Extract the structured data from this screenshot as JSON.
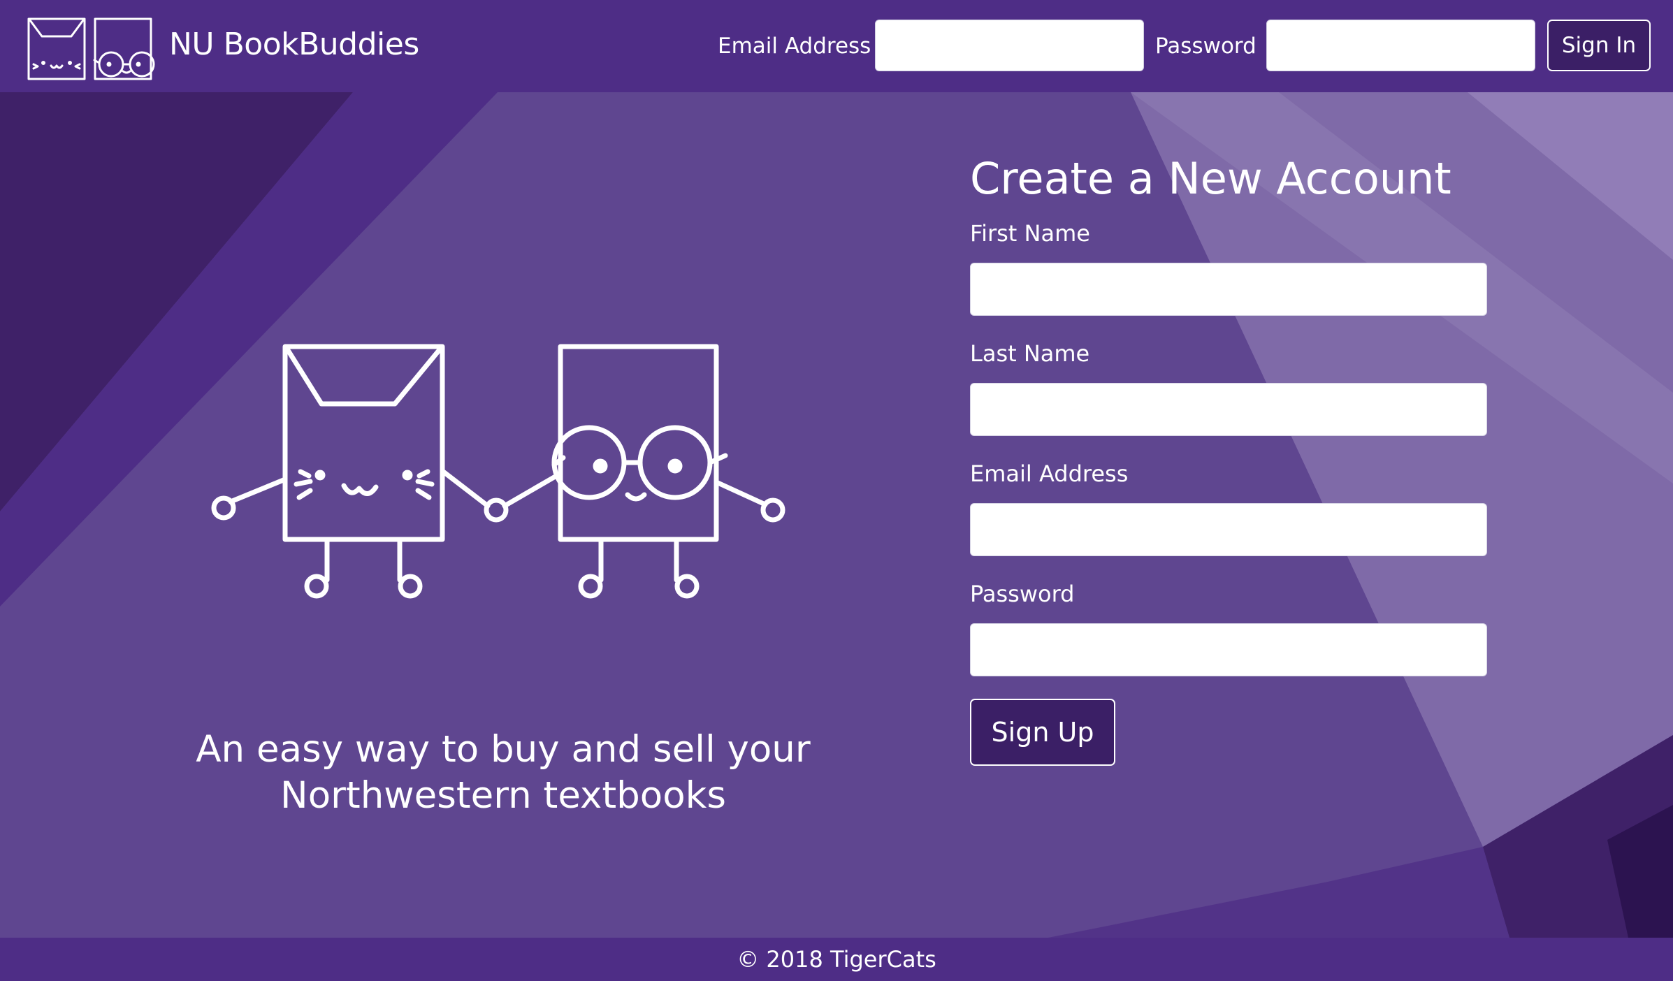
{
  "header": {
    "brand_name": "NU BookBuddies",
    "email_label": "Email Address",
    "email_value": "",
    "password_label": "Password",
    "password_value": "",
    "signin_label": "Sign In"
  },
  "hero": {
    "tagline_line1": "An easy way to buy and sell your",
    "tagline_line2": "Northwestern textbooks"
  },
  "signup": {
    "title": "Create a New Account",
    "fields": [
      {
        "label": "First Name",
        "value": ""
      },
      {
        "label": "Last Name",
        "value": ""
      },
      {
        "label": "Email Address",
        "value": ""
      },
      {
        "label": "Password",
        "value": ""
      }
    ],
    "submit_label": "Sign Up"
  },
  "footer": {
    "copyright": "© 2018 TigerCats"
  },
  "colors": {
    "navbar": "#4e2d86",
    "background": "#5f4690",
    "button": "#3b1f66",
    "text": "#ffffff"
  },
  "icons": {
    "logo": "cat-book-and-glasses-book-logo",
    "mascots": "cat-book-holding-hands-with-glasses-book"
  }
}
